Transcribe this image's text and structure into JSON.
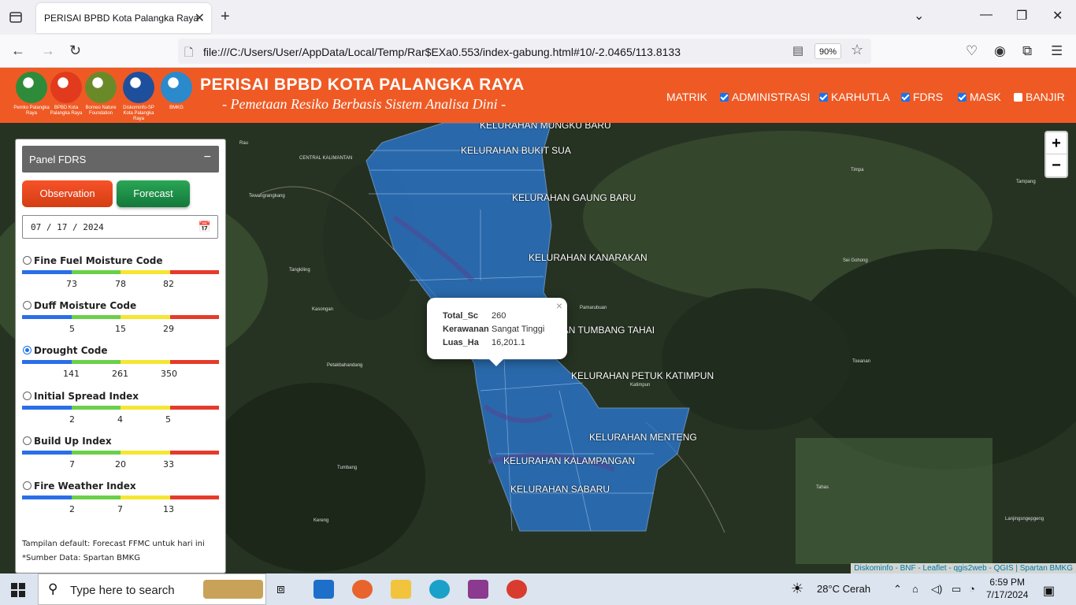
{
  "browser": {
    "tab_title": "PERISAI BPBD Kota Palangka Raya",
    "url": "file:///C:/Users/User/AppData/Local/Temp/Rar$EXa0.553/index-gabung.html#10/-2.0465/113.8133",
    "zoom": "90%"
  },
  "header": {
    "logos": [
      {
        "caption": "Pemko Palangka Raya",
        "color": "#2e8b3a"
      },
      {
        "caption": "BPBD Kota Palangka Raya",
        "color": "#e23a1c"
      },
      {
        "caption": "Borneo Nature Foundation",
        "color": "#6a8a2a"
      },
      {
        "caption": "Diskominfo-SP Kota Palangka Raya",
        "color": "#1d4f9c"
      },
      {
        "caption": "BMKG",
        "color": "#2a8acb"
      }
    ],
    "title": "PERISAI BPBD KOTA PALANGKA RAYA",
    "subtitle": "- Pemetaan Resiko Berbasis Sistem Analisa Dini -",
    "menu": [
      {
        "label": "MATRIK"
      },
      {
        "label": "ADMINISTRASI",
        "checked": true
      },
      {
        "label": "KARHUTLA",
        "checked": true
      },
      {
        "label": "FDRS",
        "checked": true
      },
      {
        "label": "MASK",
        "checked": true
      },
      {
        "label": "BANJIR",
        "checked": false
      }
    ]
  },
  "map": {
    "kelurahan_labels": [
      "KELURAHAN MUNGKU BARU",
      "KELURAHAN BUKIT SUA",
      "KELURAHAN GAUNG BARU",
      "KELURAHAN KANARAKAN",
      "KELURAHAN TUMBANG TAHAI",
      "KELURAHAN PETUK KATIMPUN",
      "KELURAHAN MENTENG",
      "KELURAHAN KALAMPANGAN",
      "KELURAHAN SABARU"
    ],
    "place_labels": [
      "Rau",
      "CENTRAL KALIMANTAN",
      "Tewangrangkang",
      "Tangkiling",
      "Kasongan",
      "Petakbahandang",
      "Tumbang",
      "Kereng",
      "Timpa",
      "Tampang",
      "Sei Gohong",
      "Pamarubuan",
      "Katimpun",
      "Tahas",
      "Toeanan",
      "Lanjingsngepgeng"
    ],
    "popup": {
      "rows": [
        {
          "key": "Total_Sc",
          "value": "260"
        },
        {
          "key": "Kerawanan",
          "value": "Sangat Tinggi"
        },
        {
          "key": "Luas_Ha",
          "value": "16,201.1"
        }
      ]
    },
    "zoom_in": "+",
    "zoom_out": "−",
    "attribution": "Diskominfo - BNF - Leaflet - qgis2web - QGIS | Spartan BMKG"
  },
  "panel": {
    "title": "Panel FDRS",
    "collapse": "−",
    "btn_observation": "Observation",
    "btn_forecast": "Forecast",
    "date": "07 / 17 / 2024",
    "scale_colors": [
      "#2a6ee8",
      "#6ad04a",
      "#f5e632",
      "#e53b2b"
    ],
    "indices": [
      {
        "label": "Fine Fuel Moisture Code",
        "ticks": [
          "73",
          "78",
          "82"
        ],
        "selected": false
      },
      {
        "label": "Duff Moisture Code",
        "ticks": [
          "5",
          "15",
          "29"
        ],
        "selected": false
      },
      {
        "label": "Drought Code",
        "ticks": [
          "141",
          "261",
          "350"
        ],
        "selected": true
      },
      {
        "label": "Initial Spread Index",
        "ticks": [
          "2",
          "4",
          "5"
        ],
        "selected": false
      },
      {
        "label": "Build Up Index",
        "ticks": [
          "7",
          "20",
          "33"
        ],
        "selected": false
      },
      {
        "label": "Fire Weather Index",
        "ticks": [
          "2",
          "7",
          "13"
        ],
        "selected": false
      }
    ],
    "note_default": "Tampilan default: Forecast FFMC untuk hari ini",
    "note_source": "*Sumber Data: Spartan BMKG"
  },
  "taskbar": {
    "search_placeholder": "Type here to search",
    "weather": "28°C  Cerah",
    "time": "6:59 PM",
    "date": "7/17/2024"
  }
}
